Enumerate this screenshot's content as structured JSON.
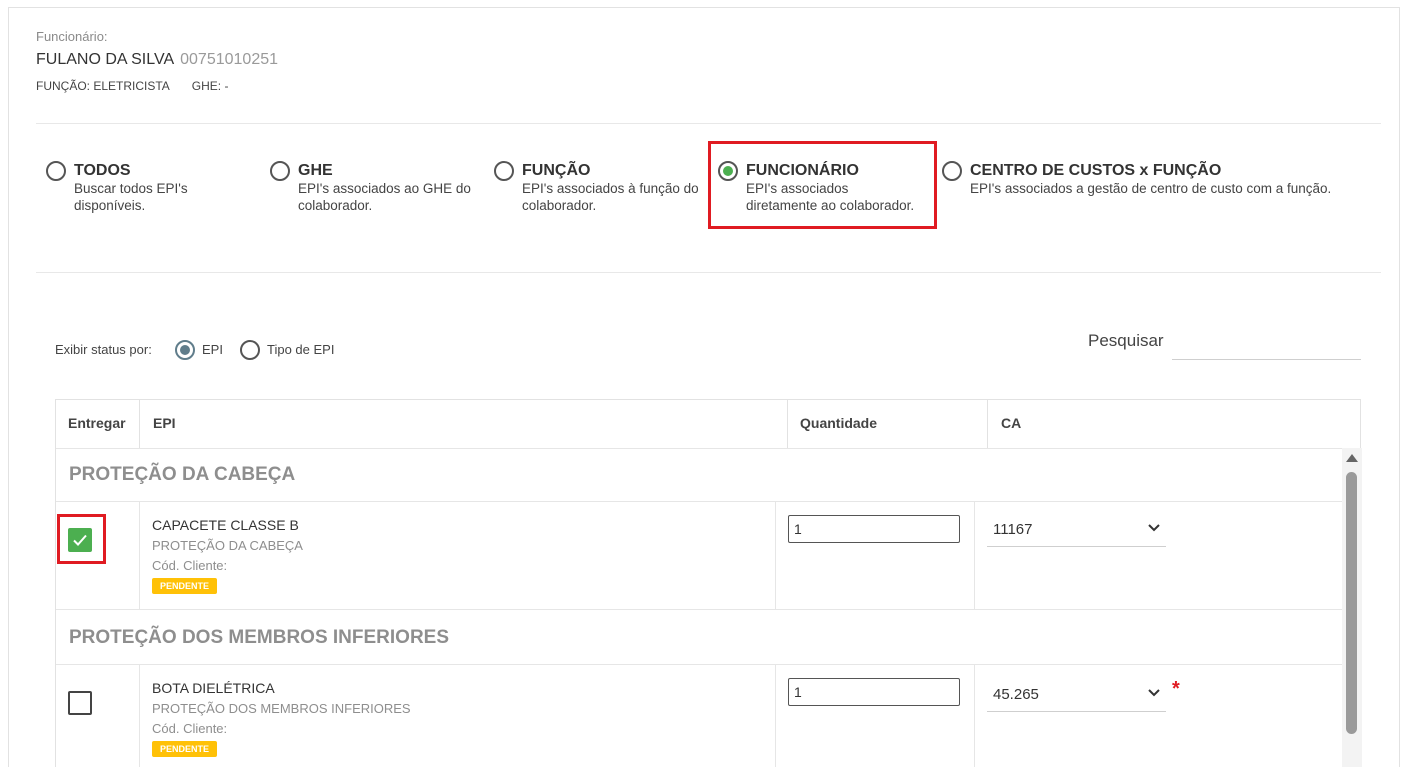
{
  "employee": {
    "label": "Funcionário:",
    "name": "FULANO DA SILVA",
    "id": "00751010251",
    "funcao": "FUNÇÃO: ELETRICISTA",
    "ghe": "GHE: -"
  },
  "filters": [
    {
      "title": "TODOS",
      "desc_line1": "Buscar todos EPI's",
      "desc_line2": "disponíveis.",
      "selected": false
    },
    {
      "title": "GHE",
      "desc_line1": "EPI's associados ao GHE do",
      "desc_line2": "colaborador.",
      "selected": false
    },
    {
      "title": "FUNÇÃO",
      "desc_line1": "EPI's associados à função do",
      "desc_line2": "colaborador.",
      "selected": false
    },
    {
      "title": "FUNCIONÁRIO",
      "desc_line1": "EPI's associados",
      "desc_line2": "diretamente ao colaborador.",
      "selected": true
    },
    {
      "title": "CENTRO DE CUSTOS x FUNÇÃO",
      "desc_line1": "EPI's associados a gestão de centro de custo com a função.",
      "desc_line2": "",
      "selected": false
    }
  ],
  "status": {
    "label": "Exibir status por:",
    "options": [
      {
        "label": "EPI",
        "selected": true
      },
      {
        "label": "Tipo de EPI",
        "selected": false
      }
    ]
  },
  "search": {
    "label": "Pesquisar",
    "value": ""
  },
  "table": {
    "headers": [
      "Entregar",
      "EPI",
      "Quantidade",
      "CA"
    ],
    "groups": [
      {
        "name": "PROTEÇÃO DA CABEÇA",
        "item": {
          "checked": true,
          "name": "CAPACETE CLASSE B",
          "category": "PROTEÇÃO DA CABEÇA",
          "cod": "Cód. Cliente:",
          "badge": "PENDENTE",
          "qty": "1",
          "ca": "11167",
          "required": false
        }
      },
      {
        "name": "PROTEÇÃO DOS MEMBROS INFERIORES",
        "item": {
          "checked": false,
          "name": "BOTA DIELÉTRICA",
          "category": "PROTEÇÃO DOS MEMBROS INFERIORES",
          "cod": "Cód. Cliente:",
          "badge": "PENDENTE",
          "qty": "1",
          "ca": "45.265",
          "required": true,
          "required_mark": "*"
        }
      }
    ]
  },
  "colors": {
    "accent_green": "#4caf50",
    "highlight_red": "#e01b22",
    "badge_yellow": "#ffc107"
  }
}
